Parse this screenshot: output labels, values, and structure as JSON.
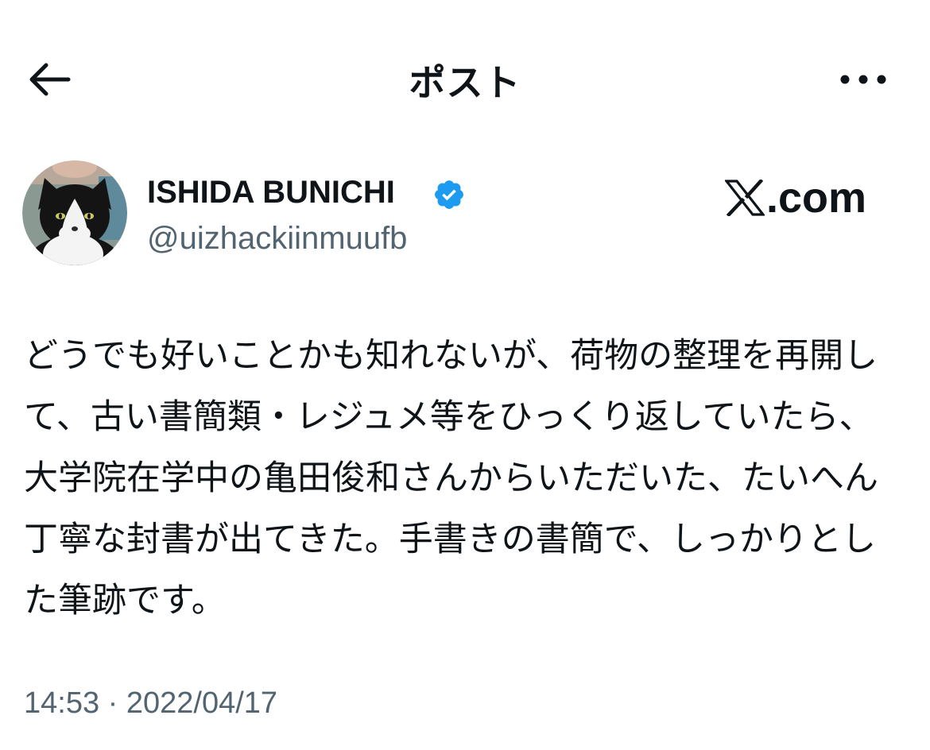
{
  "header": {
    "title": "ポスト",
    "back_icon": "arrow-left-icon",
    "more_icon": "more-horizontal-icon"
  },
  "author": {
    "display_name": "ISHIDA BUNICHI",
    "handle": "@uizhackiinmuufb",
    "verified": true,
    "verified_color": "#1d9bf0",
    "avatar": "cat-avatar"
  },
  "brand": {
    "text": ".com",
    "logo_icon": "x-logo-icon"
  },
  "post": {
    "text": "どうでも好いことかも知れないが、荷物の整理を再開して、古い書簡類・レジュメ等をひっくり返していたら、大学院在学中の亀田俊和さんからいただいた、たいへん丁寧な封書が出てきた。手書きの書簡で、しっかりとした筆跡です。",
    "timestamp": "14:53 · 2022/04/17"
  },
  "colors": {
    "text_primary": "#0f1419",
    "text_secondary": "#536471",
    "background": "#ffffff"
  }
}
